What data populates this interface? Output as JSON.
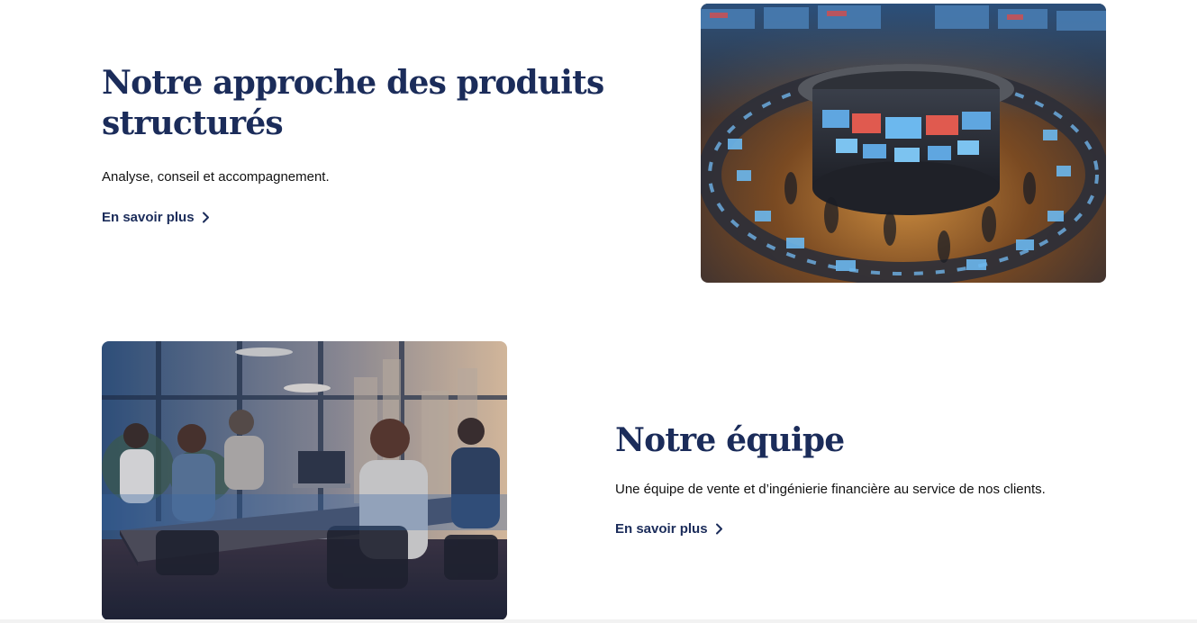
{
  "section_products": {
    "title": "Notre approche des produits structurés",
    "description": "Analyse, conseil et accompagnement.",
    "link_label": "En savoir plus",
    "image_alt": "Salle de marchés"
  },
  "section_team": {
    "title": "Notre équipe",
    "description": "Une équipe de vente et d’ingénierie financière au service  de nos clients.",
    "link_label": "En savoir plus",
    "image_alt": "Réunion d'équipe"
  },
  "icons": {
    "link_arrow": "chevron-right-icon"
  },
  "colors": {
    "heading": "#1b2c5a",
    "link": "#1b2c5a",
    "body_text": "#111111",
    "background": "#ffffff"
  }
}
